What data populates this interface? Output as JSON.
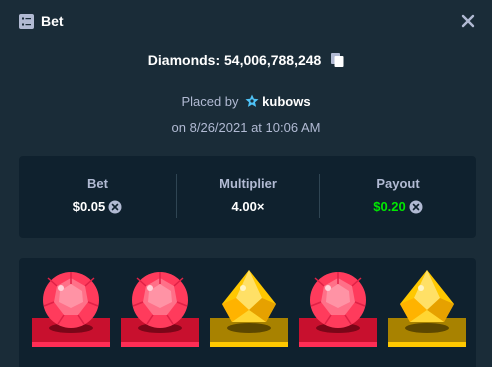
{
  "header": {
    "title": "Bet",
    "icon": "bet-list-icon",
    "close_icon": "close-icon"
  },
  "game": {
    "diamonds_label": "Diamonds: 54,006,788,248",
    "copy_icon": "copy-icon"
  },
  "placed": {
    "prefix": "Placed by",
    "username": "kubows",
    "user_icon": "star-badge-icon",
    "date": "on 8/26/2021 at 10:06 AM"
  },
  "stats": {
    "bet_label": "Bet",
    "bet_value": "$0.05",
    "multiplier_label": "Multiplier",
    "multiplier_value": "4.00×",
    "payout_label": "Payout",
    "payout_value": "$0.20",
    "currency_icon": "currency-coin-icon"
  },
  "results": [
    {
      "gem": "red",
      "icon": "red-round-gem-icon"
    },
    {
      "gem": "red",
      "icon": "red-round-gem-icon"
    },
    {
      "gem": "yellow",
      "icon": "yellow-gem-icon"
    },
    {
      "gem": "red",
      "icon": "red-round-gem-icon"
    },
    {
      "gem": "yellow",
      "icon": "yellow-gem-icon"
    }
  ],
  "colors": {
    "background": "#1a2c38",
    "panel": "#0f212e",
    "muted_text": "#b1bad3",
    "payout_green": "#00e701",
    "red_gem": "#ff3b5c",
    "yellow_gem": "#ffc800"
  }
}
